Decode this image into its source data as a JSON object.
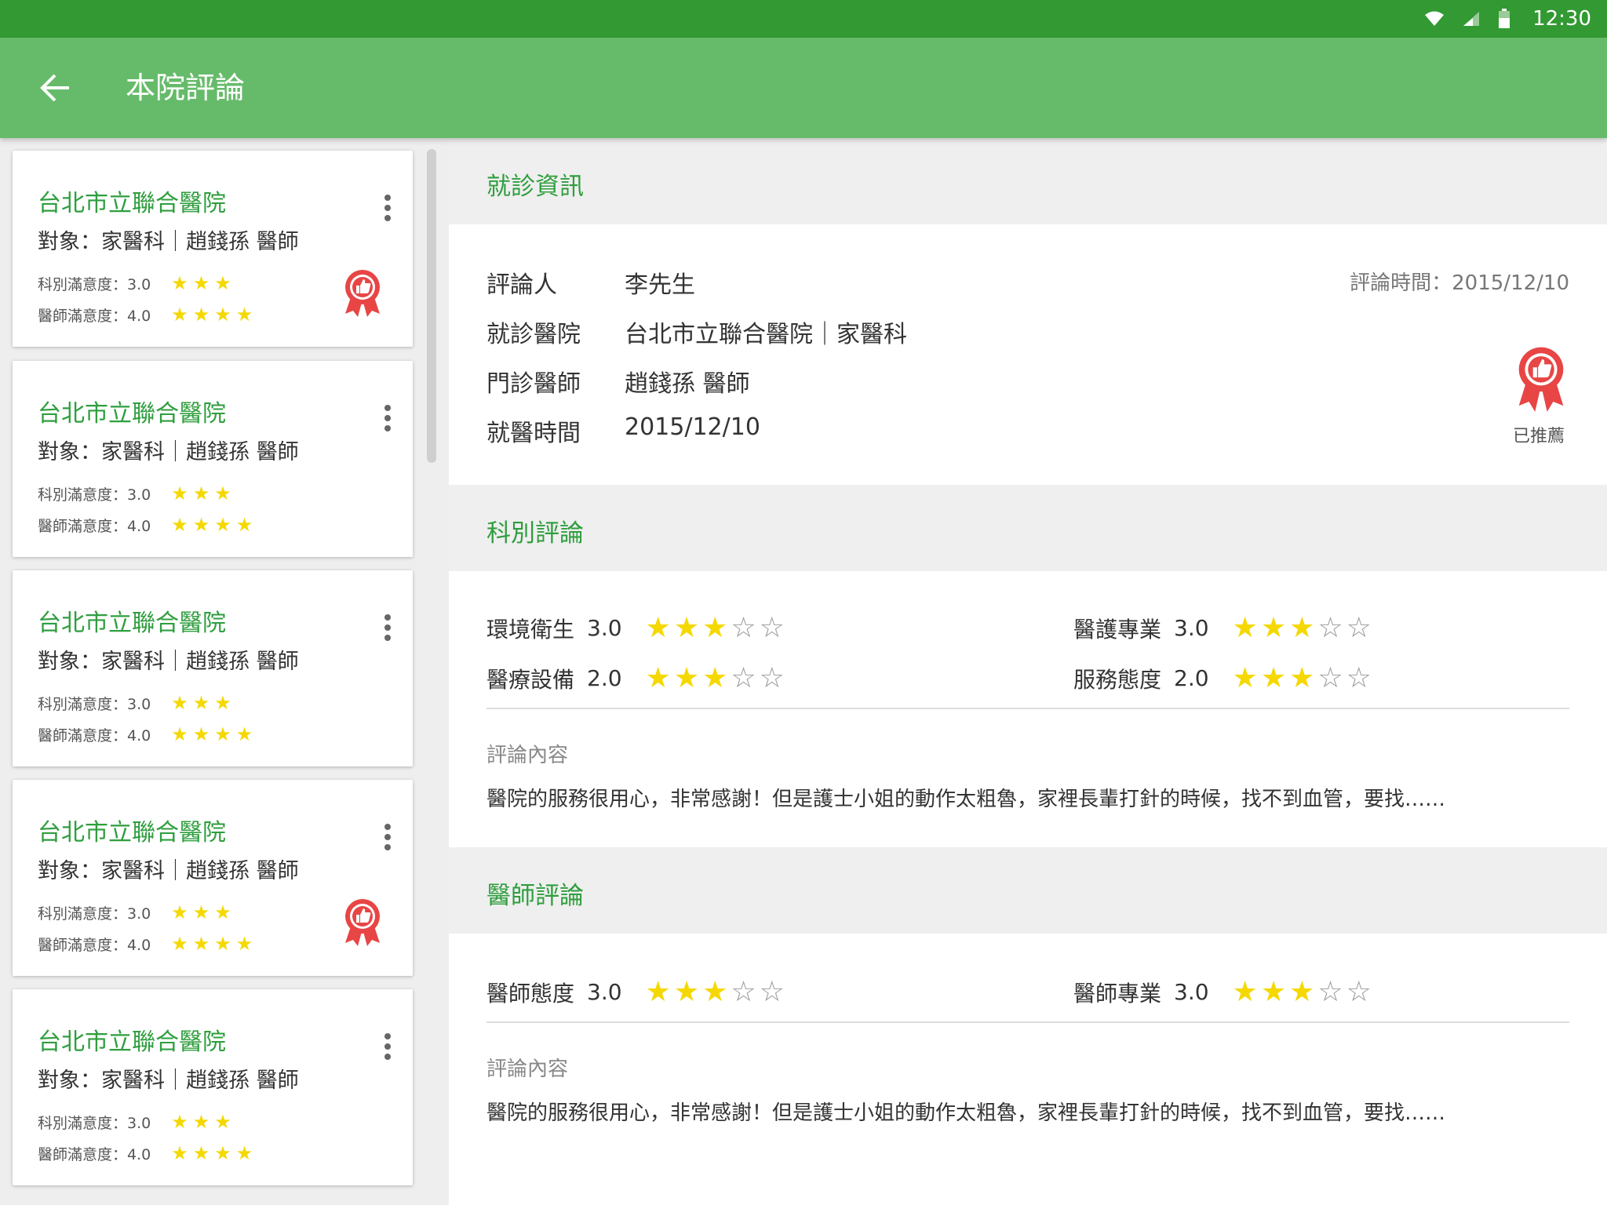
{
  "status": {
    "time": "12:30"
  },
  "appbar": {
    "title": "本院評論"
  },
  "cards": [
    {
      "hospital": "台北市立聯合醫院",
      "target": "對象：家醫科｜趙錢孫 醫師",
      "dept_label": "科別滿意度：3.0",
      "doc_label": "醫師滿意度：4.0",
      "dept_stars": "★★★",
      "doc_stars": "★★★★",
      "recommended": true
    },
    {
      "hospital": "台北市立聯合醫院",
      "target": "對象：家醫科｜趙錢孫 醫師",
      "dept_label": "科別滿意度：3.0",
      "doc_label": "醫師滿意度：4.0",
      "dept_stars": "★★★",
      "doc_stars": "★★★★",
      "recommended": false
    },
    {
      "hospital": "台北市立聯合醫院",
      "target": "對象：家醫科｜趙錢孫 醫師",
      "dept_label": "科別滿意度：3.0",
      "doc_label": "醫師滿意度：4.0",
      "dept_stars": "★★★",
      "doc_stars": "★★★★",
      "recommended": false
    },
    {
      "hospital": "台北市立聯合醫院",
      "target": "對象：家醫科｜趙錢孫 醫師",
      "dept_label": "科別滿意度：3.0",
      "doc_label": "醫師滿意度：4.0",
      "dept_stars": "★★★",
      "doc_stars": "★★★★",
      "recommended": true
    },
    {
      "hospital": "台北市立聯合醫院",
      "target": "對象：家醫科｜趙錢孫 醫師",
      "dept_label": "科別滿意度：3.0",
      "doc_label": "醫師滿意度：4.0",
      "dept_stars": "★★★",
      "doc_stars": "★★★★",
      "recommended": false
    }
  ],
  "visit": {
    "header": "就診資訊",
    "reviewer_label": "評論人",
    "reviewer": "李先生",
    "hospital_label": "就診醫院",
    "hospital": "台北市立聯合醫院｜家醫科",
    "doctor_label": "門診醫師",
    "doctor": "趙錢孫 醫師",
    "date_label": "就醫時間",
    "date": "2015/12/10",
    "review_time": "評論時間：2015/12/10",
    "recommended_label": "已推薦"
  },
  "dept_review": {
    "header": "科別評論",
    "items": [
      {
        "label": "環境衛生",
        "score": "3.0",
        "filled": 3
      },
      {
        "label": "醫護專業",
        "score": "3.0",
        "filled": 3
      },
      {
        "label": "醫療設備",
        "score": "2.0",
        "filled": 3
      },
      {
        "label": "服務態度",
        "score": "2.0",
        "filled": 3
      }
    ],
    "content_label": "評論內容",
    "content": "醫院的服務很用心，非常感謝！但是護士小姐的動作太粗魯，家裡長輩打針的時候，找不到血管，要找……"
  },
  "doctor_review": {
    "header": "醫師評論",
    "items": [
      {
        "label": "醫師態度",
        "score": "3.0",
        "filled": 3
      },
      {
        "label": "醫師專業",
        "score": "3.0",
        "filled": 3
      }
    ],
    "content_label": "評論內容",
    "content": "醫院的服務很用心，非常感謝！但是護士小姐的動作太粗魯，家裡長輩打針的時候，找不到血管，要找……"
  },
  "colors": {
    "statusbar": "#339933",
    "appbar": "#66bb6a",
    "accent": "#2f9e3e",
    "star": "#f5d800",
    "badge": "#e84545"
  }
}
